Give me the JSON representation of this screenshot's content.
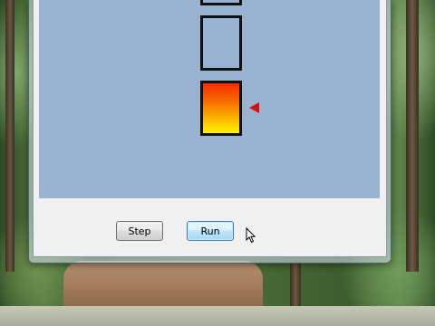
{
  "window": {
    "buttons": {
      "step_label": "Step",
      "run_label": "Run"
    }
  },
  "canvas": {
    "background_color": "#9ab3d1",
    "cells": [
      {
        "state": "empty"
      },
      {
        "state": "empty"
      },
      {
        "state": "filled",
        "gradient": [
          "#f42d00",
          "#fff200"
        ]
      }
    ],
    "pointer": {
      "icon": "triangle-left",
      "color": "#d51010",
      "points_at_cell": 3
    }
  },
  "cursor": {
    "icon": "arrow-cursor"
  }
}
